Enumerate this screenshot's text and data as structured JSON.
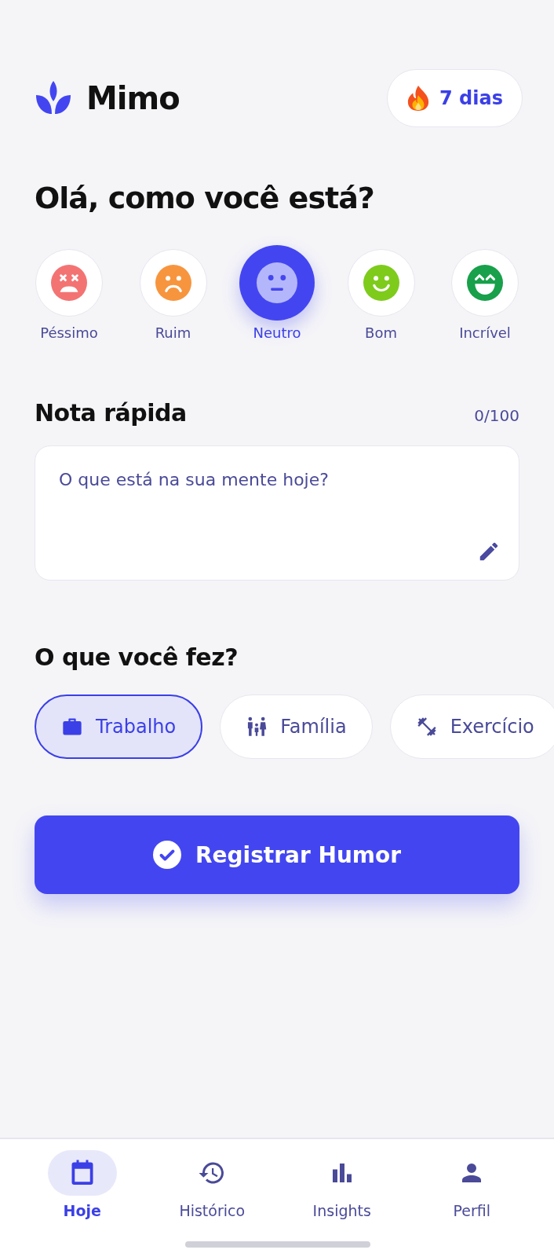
{
  "app": {
    "name": "Mimo"
  },
  "streak": {
    "label": "7 dias"
  },
  "greeting": "Olá, como você está?",
  "moods": [
    {
      "kind": "awful",
      "label": "Péssimo",
      "color": "#f37373",
      "selected": false
    },
    {
      "kind": "bad",
      "label": "Ruim",
      "color": "#f7953e",
      "selected": false
    },
    {
      "kind": "neutral",
      "label": "Neutro",
      "color": "#b4b6fb",
      "selected": true
    },
    {
      "kind": "good",
      "label": "Bom",
      "color": "#7ecb1c",
      "selected": false
    },
    {
      "kind": "great",
      "label": "Incrível",
      "color": "#18a04a",
      "selected": false
    }
  ],
  "note": {
    "title": "Nota rápida",
    "counter": "0/100",
    "placeholder": "O que está na sua mente hoje?"
  },
  "activities": {
    "title": "O que você fez?",
    "items": [
      {
        "kind": "work",
        "label": "Trabalho",
        "selected": true
      },
      {
        "kind": "family",
        "label": "Família",
        "selected": false
      },
      {
        "kind": "exercise",
        "label": "Exercício",
        "selected": false
      }
    ]
  },
  "submit": {
    "label": "Registrar Humor"
  },
  "nav": [
    {
      "kind": "today",
      "label": "Hoje",
      "selected": true
    },
    {
      "kind": "history",
      "label": "Histórico",
      "selected": false
    },
    {
      "kind": "insights",
      "label": "Insights",
      "selected": false
    },
    {
      "kind": "profile",
      "label": "Perfil",
      "selected": false
    }
  ]
}
